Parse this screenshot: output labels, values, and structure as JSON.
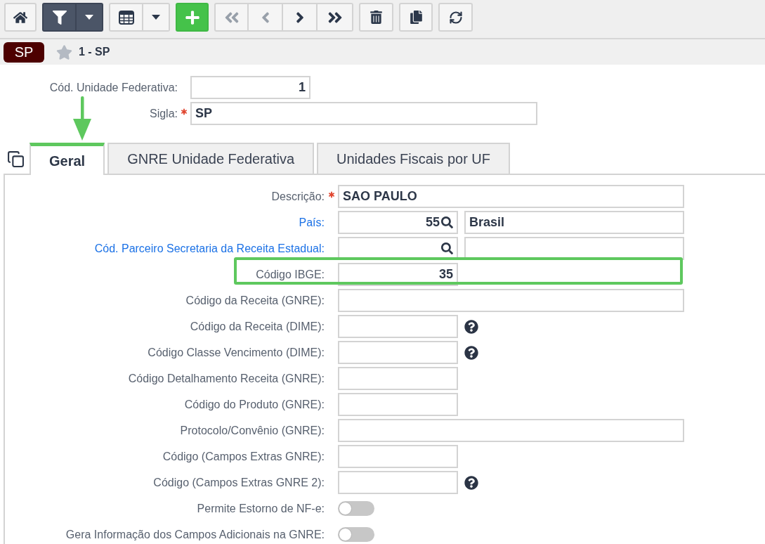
{
  "toolbar": [
    {
      "active": false,
      "buttons": [
        {
          "kind": "home",
          "disabled": false
        }
      ]
    },
    {
      "active": true,
      "buttons": [
        {
          "kind": "filter",
          "disabled": false
        },
        {
          "kind": "caret",
          "disabled": false
        }
      ]
    },
    {
      "active": false,
      "buttons": [
        {
          "kind": "grid",
          "disabled": false
        },
        {
          "kind": "caret",
          "disabled": false
        }
      ]
    },
    {
      "active": false,
      "buttons": [
        {
          "kind": "add",
          "disabled": false
        }
      ]
    },
    {
      "active": false,
      "buttons": [
        {
          "kind": "first",
          "disabled": true
        },
        {
          "kind": "previous",
          "disabled": true
        },
        {
          "kind": "next",
          "disabled": false
        },
        {
          "kind": "last",
          "disabled": false
        }
      ]
    },
    {
      "active": false,
      "buttons": [
        {
          "kind": "delete",
          "disabled": false
        }
      ]
    },
    {
      "active": false,
      "buttons": [
        {
          "kind": "duplicate",
          "disabled": false
        }
      ]
    },
    {
      "active": false,
      "buttons": [
        {
          "kind": "refresh",
          "disabled": false
        }
      ]
    }
  ],
  "breadcrumb": {
    "badge": "SP",
    "favorite": false,
    "title": "1 - SP"
  },
  "header_fields": [
    {
      "label": "Cód. Unidade Federativa:",
      "kind": "code",
      "required": false,
      "value": "1"
    },
    {
      "label": "Sigla:",
      "kind": "text",
      "required": true,
      "value": "SP"
    }
  ],
  "tabs": [
    {
      "label": "Geral",
      "selected": true,
      "highlighted": true
    },
    {
      "label": "GNRE Unidade Federativa",
      "selected": false,
      "highlighted": false
    },
    {
      "label": "Unidades Fiscais por UF",
      "selected": false,
      "highlighted": false
    }
  ],
  "fields": [
    {
      "label": "Descrição:",
      "kind": "text",
      "required": true,
      "link": false,
      "help": false,
      "highlighted": false,
      "value": "SAO PAULO"
    },
    {
      "label": "País:",
      "kind": "lookup",
      "required": false,
      "link": true,
      "help": false,
      "highlighted": false,
      "value": "55",
      "description": "Brasil"
    },
    {
      "label": "Cód. Parceiro Secretaria da Receita Estadual:",
      "kind": "lookup",
      "required": false,
      "link": true,
      "help": false,
      "highlighted": false
    },
    {
      "label": "Código IBGE:",
      "kind": "code",
      "required": false,
      "link": false,
      "help": false,
      "highlighted": true,
      "value": "35"
    },
    {
      "label": "Código da Receita (GNRE):",
      "kind": "text",
      "required": false,
      "link": false,
      "help": false,
      "highlighted": false
    },
    {
      "label": "Código da Receita (DIME):",
      "kind": "code",
      "required": false,
      "link": false,
      "help": true,
      "highlighted": false
    },
    {
      "label": "Código Classe Vencimento (DIME):",
      "kind": "code",
      "required": false,
      "link": false,
      "help": true,
      "highlighted": false
    },
    {
      "label": "Código Detalhamento Receita (GNRE):",
      "kind": "code",
      "required": false,
      "link": false,
      "help": false,
      "highlighted": false
    },
    {
      "label": "Código do Produto (GNRE):",
      "kind": "code",
      "required": false,
      "link": false,
      "help": false,
      "highlighted": false
    },
    {
      "label": "Protocolo/Convênio (GNRE):",
      "kind": "text",
      "required": false,
      "link": false,
      "help": false,
      "highlighted": false
    },
    {
      "label": "Código (Campos Extras GNRE):",
      "kind": "code",
      "required": false,
      "link": false,
      "help": false,
      "highlighted": false
    },
    {
      "label": "Código (Campos Extras GNRE 2):",
      "kind": "code",
      "required": false,
      "link": false,
      "help": true,
      "highlighted": false
    },
    {
      "label": "Permite Estorno de NF-e:",
      "kind": "toggle",
      "required": false,
      "link": false,
      "help": false,
      "highlighted": false,
      "on": false
    },
    {
      "label": "Gera Informação dos Campos Adicionais na GNRE:",
      "kind": "toggle",
      "required": false,
      "link": false,
      "help": false,
      "highlighted": false,
      "on": false
    }
  ]
}
